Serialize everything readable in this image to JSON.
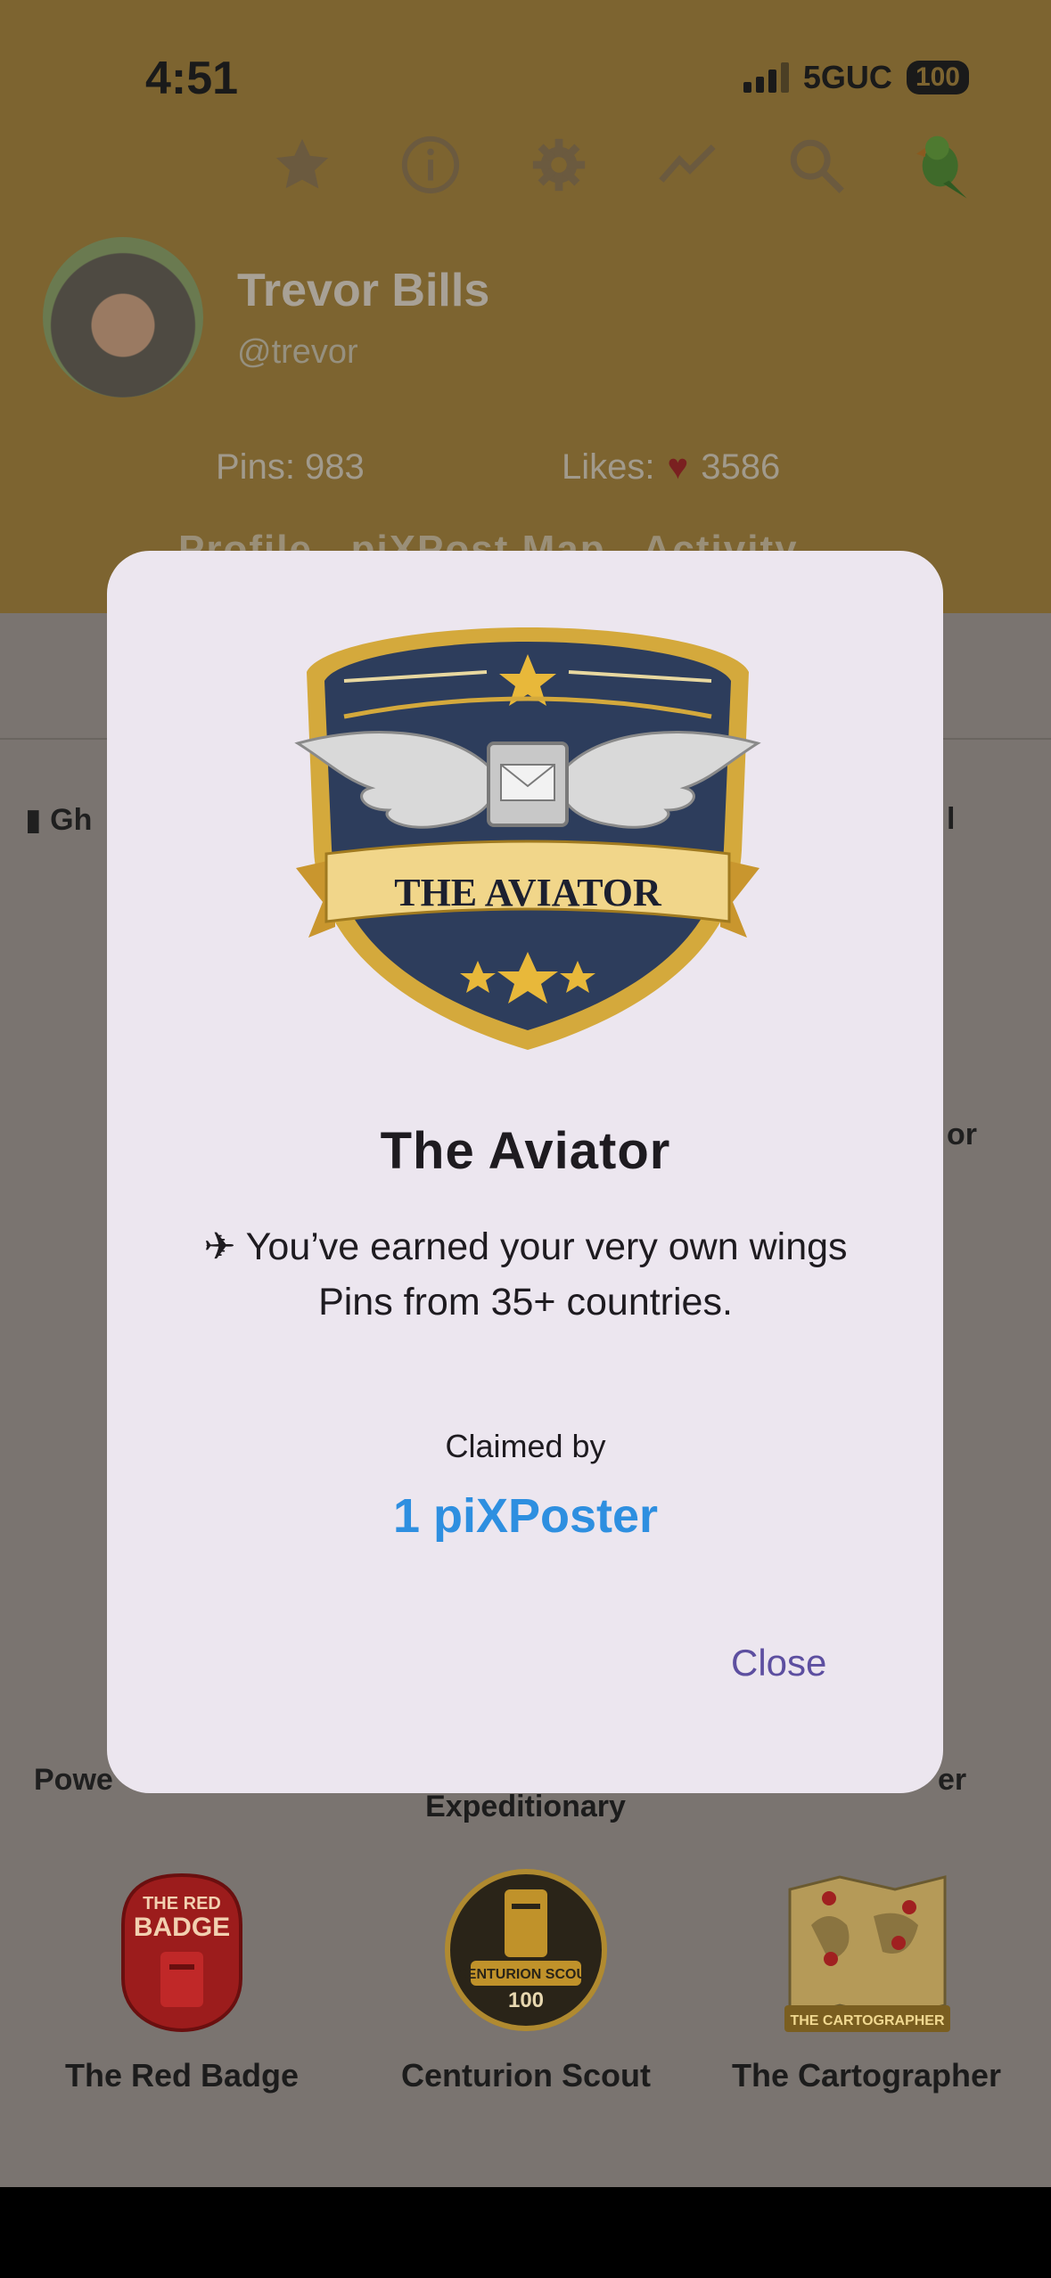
{
  "status_bar": {
    "time": "4:51",
    "network": "5GUC",
    "battery": "100"
  },
  "toolbar": {
    "icons": [
      "star-icon",
      "info-icon",
      "gear-icon",
      "trend-icon",
      "search-icon",
      "parrot-icon"
    ]
  },
  "profile": {
    "name": "Trevor Bills",
    "handle": "@trevor",
    "pins_label": "Pins: 983",
    "likes_label": "Likes:",
    "likes_count": "3586",
    "tabs_faded": "Profile   piXPost Map   Activity"
  },
  "background_badges": {
    "left_edge_labels": [
      "Gh",
      "Powe"
    ],
    "right_edge_labels": [
      "l",
      "or",
      "er"
    ],
    "partial_label": "Expeditionary",
    "row": [
      {
        "label": "The Red Badge",
        "icon": "red-badge-icon"
      },
      {
        "label": "Centurion Scout",
        "icon": "centurion-scout-icon"
      },
      {
        "label": "The Cartographer",
        "icon": "cartographer-icon"
      }
    ]
  },
  "modal": {
    "badge_banner": "THE AVIATOR",
    "title": "The Aviator",
    "description_line1": "✈ You’ve earned your very own wings",
    "description_line2": "Pins from 35+ countries.",
    "claimed_by_label": "Claimed by",
    "claimed_by_value": "1 piXPoster",
    "close_label": "Close"
  },
  "colors": {
    "accent": "#2e8fe0",
    "close": "#5d4fa0",
    "modal_bg": "#ece6ef",
    "header_bg": "#7d6430"
  }
}
